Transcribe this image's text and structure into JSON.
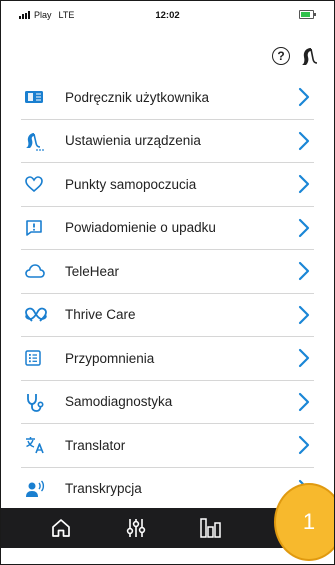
{
  "status_bar": {
    "carrier": "Play",
    "network": "LTE",
    "time": "12:02"
  },
  "menu_items": [
    {
      "label": "Podręcznik użytkownika",
      "icon": "book-icon"
    },
    {
      "label": "Ustawienia urządzenia",
      "icon": "hearing-aid-settings-icon"
    },
    {
      "label": "Punkty samopoczucia",
      "icon": "heart-icon"
    },
    {
      "label": "Powiadomienie o upadku",
      "icon": "alert-message-icon"
    },
    {
      "label": "TeleHear",
      "icon": "cloud-icon"
    },
    {
      "label": "Thrive Care",
      "icon": "linked-hearts-icon"
    },
    {
      "label": "Przypomnienia",
      "icon": "list-icon"
    },
    {
      "label": "Samodiagnostyka",
      "icon": "stethoscope-icon"
    },
    {
      "label": "Translator",
      "icon": "translate-icon"
    },
    {
      "label": "Transkrypcja",
      "icon": "speaker-person-icon"
    }
  ],
  "tabs": [
    {
      "name": "home",
      "icon": "home-icon"
    },
    {
      "name": "adjust",
      "icon": "sliders-icon"
    },
    {
      "name": "stats",
      "icon": "bar-chart-icon"
    }
  ],
  "badge": {
    "number": "1"
  },
  "colors": {
    "accent": "#1a86d6",
    "icon_blue": "#1a7fd0",
    "tabbar": "#1c1c1e",
    "badge": "#f7b92d"
  }
}
